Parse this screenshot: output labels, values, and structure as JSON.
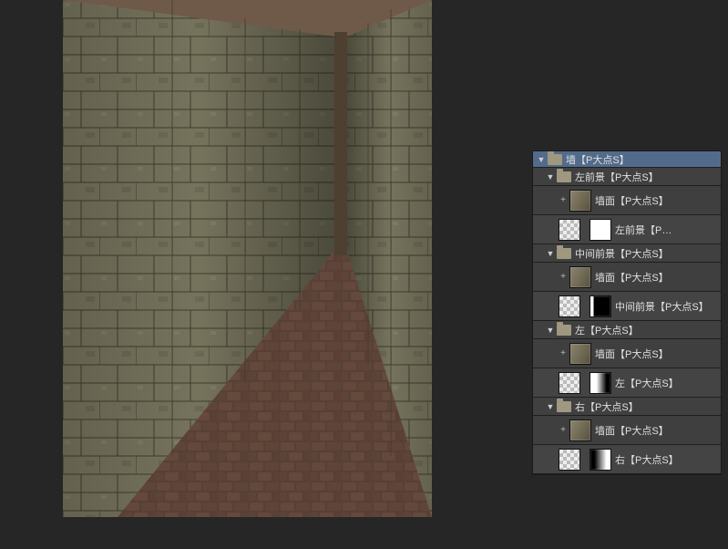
{
  "layers_panel": {
    "root": {
      "label": "墙【P大点S】",
      "expanded": true
    },
    "groups": [
      {
        "id": "left-front",
        "label": "左前景【P大点S】",
        "expanded": true,
        "children": [
          {
            "id": "lf-wall",
            "kind": "wall-layer",
            "label": "墙面【P大点S】",
            "thumbs": [
              "wall"
            ],
            "expand": "plus"
          },
          {
            "id": "lf-mask",
            "kind": "mask-layer",
            "label": "左前景【P…",
            "thumbs": [
              "checker",
              "mask-white"
            ]
          }
        ]
      },
      {
        "id": "mid-front",
        "label": "中间前景【P大点S】",
        "expanded": true,
        "children": [
          {
            "id": "mf-wall",
            "kind": "wall-layer",
            "label": "墙面【P大点S】",
            "thumbs": [
              "wall"
            ],
            "expand": "plus"
          },
          {
            "id": "mf-mask",
            "kind": "mask-layer",
            "label": "中间前景【P大点S】",
            "thumbs": [
              "checker",
              "mask-narrow"
            ]
          }
        ]
      },
      {
        "id": "left",
        "label": "左【P大点S】",
        "expanded": true,
        "children": [
          {
            "id": "l-wall",
            "kind": "wall-layer",
            "label": "墙面【P大点S】",
            "thumbs": [
              "wall"
            ],
            "expand": "plus"
          },
          {
            "id": "l-mask",
            "kind": "mask-layer",
            "label": "左【P大点S】",
            "thumbs": [
              "checker",
              "mask-gradL"
            ]
          }
        ]
      },
      {
        "id": "right",
        "label": "右【P大点S】",
        "expanded": true,
        "children": [
          {
            "id": "r-wall",
            "kind": "wall-layer",
            "label": "墙面【P大点S】",
            "thumbs": [
              "wall"
            ],
            "expand": "plus"
          },
          {
            "id": "r-mask",
            "kind": "mask-layer",
            "label": "右【P大点S】",
            "thumbs": [
              "checker",
              "mask-gradR"
            ]
          }
        ]
      }
    ]
  },
  "glyphs": {
    "tw_open": "▼",
    "plus": "+"
  }
}
